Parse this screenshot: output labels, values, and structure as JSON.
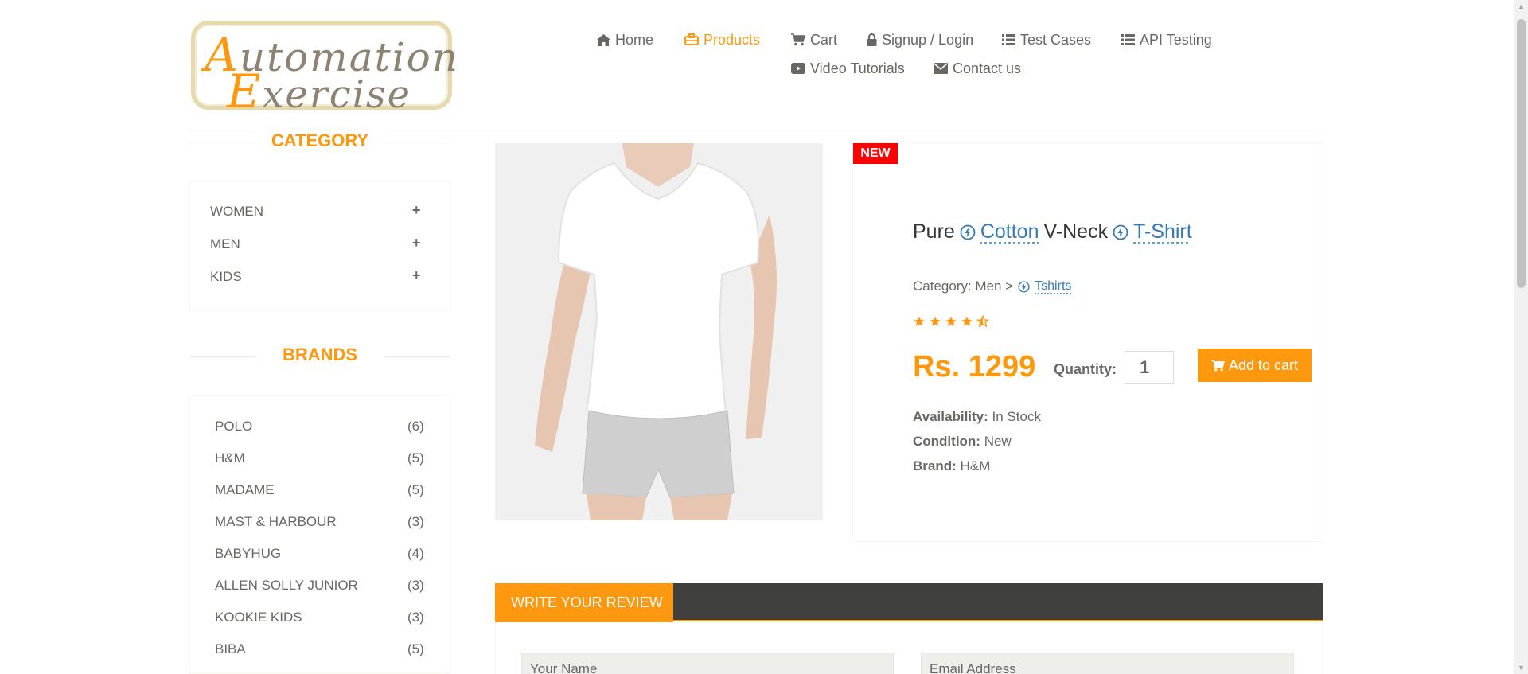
{
  "logo": {
    "line1": "Automation",
    "line2": "Exercise"
  },
  "nav": {
    "home": "Home",
    "products": "Products",
    "cart": "Cart",
    "signup": "Signup / Login",
    "test_cases": "Test Cases",
    "api_testing": "API Testing",
    "video_tutorials": "Video Tutorials",
    "contact": "Contact us"
  },
  "sidebar": {
    "category_title": "CATEGORY",
    "categories": [
      {
        "label": "WOMEN",
        "icon": "plus-icon"
      },
      {
        "label": "MEN",
        "icon": "plus-icon"
      },
      {
        "label": "KIDS",
        "icon": "plus-icon"
      }
    ],
    "brands_title": "BRANDS",
    "brands": [
      {
        "name": "POLO",
        "count": "(6)"
      },
      {
        "name": "H&M",
        "count": "(5)"
      },
      {
        "name": "MADAME",
        "count": "(5)"
      },
      {
        "name": "MAST & HARBOUR",
        "count": "(3)"
      },
      {
        "name": "BABYHUG",
        "count": "(4)"
      },
      {
        "name": "ALLEN SOLLY JUNIOR",
        "count": "(3)"
      },
      {
        "name": "KOOKIE KIDS",
        "count": "(3)"
      },
      {
        "name": "BIBA",
        "count": "(5)"
      }
    ]
  },
  "product": {
    "badge": "NEW",
    "name_part1": "Pure",
    "name_link1": "Cotton",
    "name_part2": "V-Neck",
    "name_link2": "T-Shirt",
    "category_prefix": "Category: Men >",
    "category_link": "Tshirts",
    "rating": 4.5,
    "price": "Rs. 1299",
    "quantity_label": "Quantity:",
    "quantity_value": "1",
    "add_to_cart": "Add to cart",
    "availability_label": "Availability:",
    "availability_value": "In Stock",
    "condition_label": "Condition:",
    "condition_value": "New",
    "brand_label": "Brand:",
    "brand_value": "H&M"
  },
  "review": {
    "tab_label": "WRITE YOUR REVIEW",
    "name_placeholder": "Your Name",
    "email_placeholder": "Email Address"
  },
  "colors": {
    "accent": "#fe980f",
    "text": "#696763",
    "link": "#337ab7",
    "badge": "#ff0000",
    "review_bar": "#40403e"
  }
}
